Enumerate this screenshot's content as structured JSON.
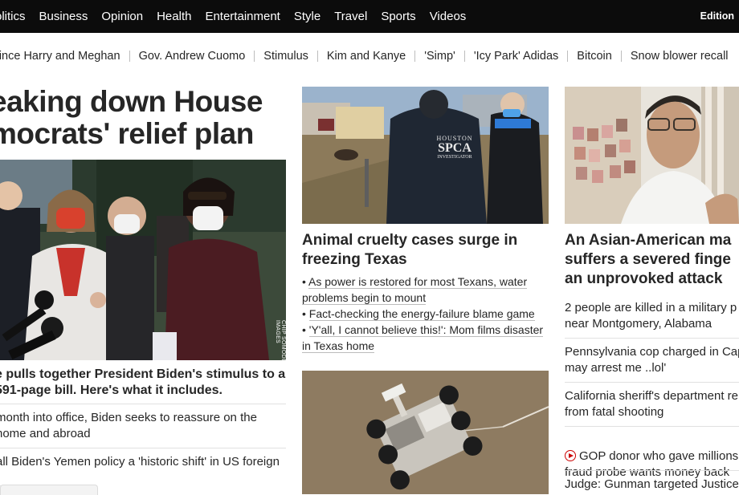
{
  "topnav": {
    "links": [
      "olitics",
      "Business",
      "Opinion",
      "Health",
      "Entertainment",
      "Style",
      "Travel",
      "Sports",
      "Videos"
    ],
    "edition": "Edition"
  },
  "trending": [
    "rince Harry and Meghan",
    "Gov. Andrew Cuomo",
    "Stimulus",
    "Kim and Kanye",
    "'Simp'",
    "'Icy Park' Adidas",
    "Bitcoin",
    "Snow blower recall"
  ],
  "left": {
    "headline": "eaking down House\nmocrats' relief plan",
    "photo_credit": "CHIP SOMODEVILLA/GETTY IMAGES",
    "caption": "e pulls together President Biden's stimulus to a 591-page bill. Here's what it includes.",
    "items": [
      "month into office, Biden seeks to reassure on the home and abroad",
      "all Biden's Yemen policy a 'historic shift' in US foreign"
    ]
  },
  "middle": {
    "headline": "Animal cruelty cases surge in freezing Texas",
    "bullets": [
      "As power is restored for most Texans, water problems begin to mount",
      "Fact-checking the energy-failure blame game",
      "'Y'all, I cannot believe this!': Mom films disaster in Texas home"
    ],
    "vest_text": [
      "HOUSTON",
      "SPCA",
      "INVESTIGATOR"
    ]
  },
  "right": {
    "headline": "An Asian-American ma\nsuffers a severed finge\nan unprovoked attack",
    "items": [
      "2 people are killed in a military p\nnear Montgomery, Alabama",
      "Pennsylvania cop charged in Cap\nmay arrest me ..lol'",
      "California sheriff's department re\nfrom fatal shooting",
      "GOP donor who gave millions\nfraud probe wants money back",
      "Judge: Gunman targeted Justice"
    ]
  },
  "colors": {
    "nav_bg": "#0c0c0c",
    "text": "#262626",
    "video_red": "#cc0000"
  }
}
